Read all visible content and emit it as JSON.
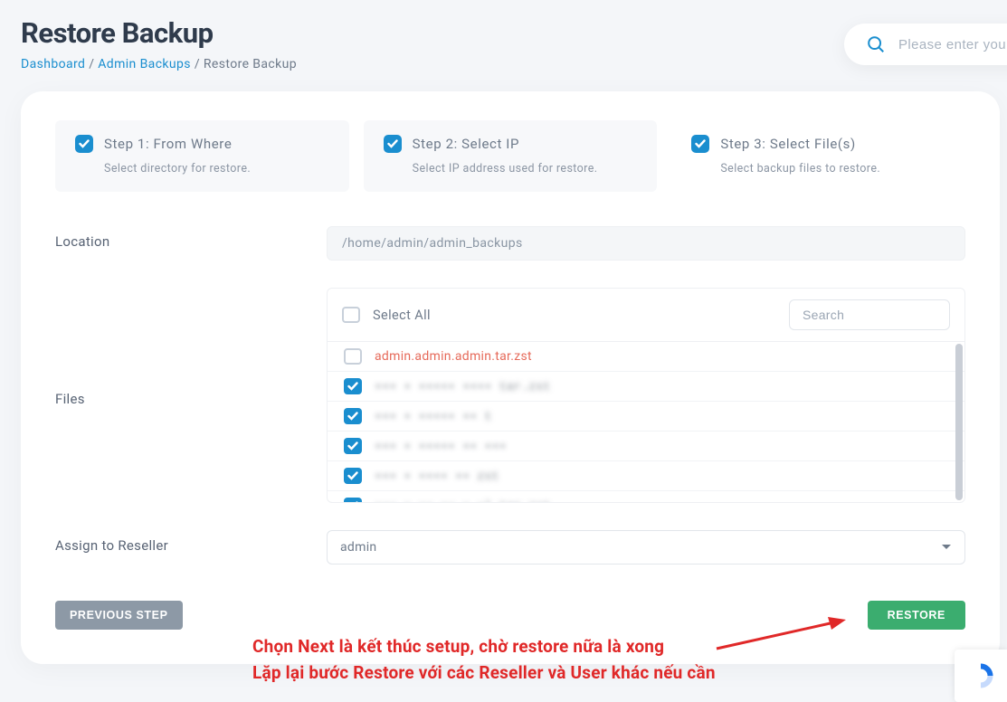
{
  "header": {
    "title": "Restore Backup",
    "breadcrumb": {
      "dashboard": "Dashboard",
      "admin_backups": "Admin Backups",
      "current": "Restore Backup"
    }
  },
  "search": {
    "placeholder": "Please enter your s"
  },
  "steps": [
    {
      "title": "Step 1: From Where",
      "subtitle": "Select directory for restore."
    },
    {
      "title": "Step 2: Select IP",
      "subtitle": "Select IP address used for restore."
    },
    {
      "title": "Step 3: Select File(s)",
      "subtitle": "Select backup files to restore."
    }
  ],
  "form": {
    "location_label": "Location",
    "location_value": "/home/admin/admin_backups",
    "files_label": "Files",
    "select_all_label": "Select All",
    "search_placeholder": "Search",
    "assign_label": "Assign to Reseller",
    "assign_value": "admin"
  },
  "files": [
    {
      "checked": false,
      "highlight": true,
      "name": "admin.admin.admin.tar.zst",
      "blurred": false
    },
    {
      "checked": true,
      "highlight": false,
      "name": "▪▪▪ ▪   ▪▪▪▪▪ ▪▪▪▪ tar.zst",
      "blurred": true
    },
    {
      "checked": true,
      "highlight": false,
      "name": "▪▪▪ ▪   ▪▪▪▪▪ ▪▪ t",
      "blurred": true
    },
    {
      "checked": true,
      "highlight": false,
      "name": "▪▪▪ ▪   ▪▪▪▪▪ ▪▪ ▪▪▪",
      "blurred": true
    },
    {
      "checked": true,
      "highlight": false,
      "name": "▪▪▪ ▪   ▪▪▪▪ ▪▪ zst",
      "blurred": true
    },
    {
      "checked": true,
      "highlight": false,
      "name": "▪▪▪ ▪   ▪▪ ▪▪ ▪ ▪l.tar.zst",
      "blurred": true
    }
  ],
  "actions": {
    "prev": "PREVIOUS STEP",
    "go": "RESTORE"
  },
  "note": {
    "line1": "Chọn Next là kết thúc setup, chờ restore nữa là xong",
    "line2": "Lặp lại bước Restore với các Reseller và User khác nếu cần"
  }
}
